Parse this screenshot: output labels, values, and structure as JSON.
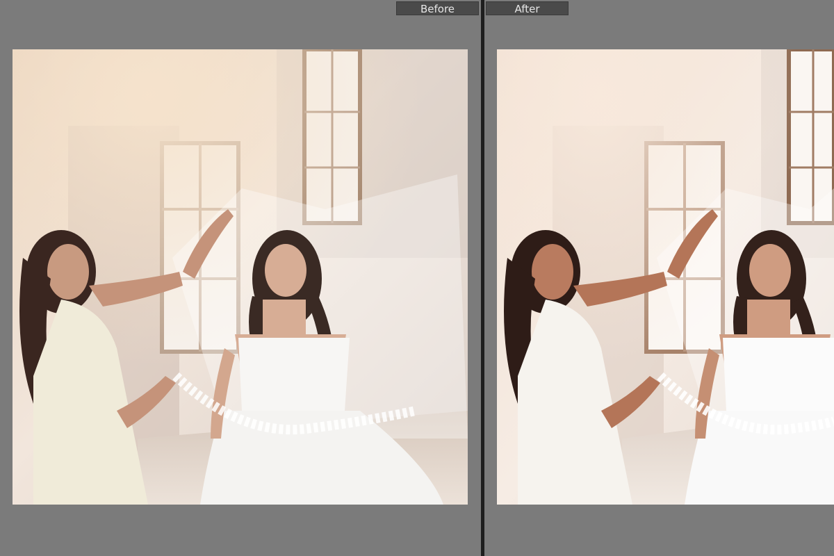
{
  "labels": {
    "before": "Before",
    "after": "After"
  },
  "colors": {
    "background": "#7b7b7b",
    "divider": "#1e1e1e",
    "label_bg": "#4a4a4a",
    "label_text": "#e6e6e6"
  }
}
